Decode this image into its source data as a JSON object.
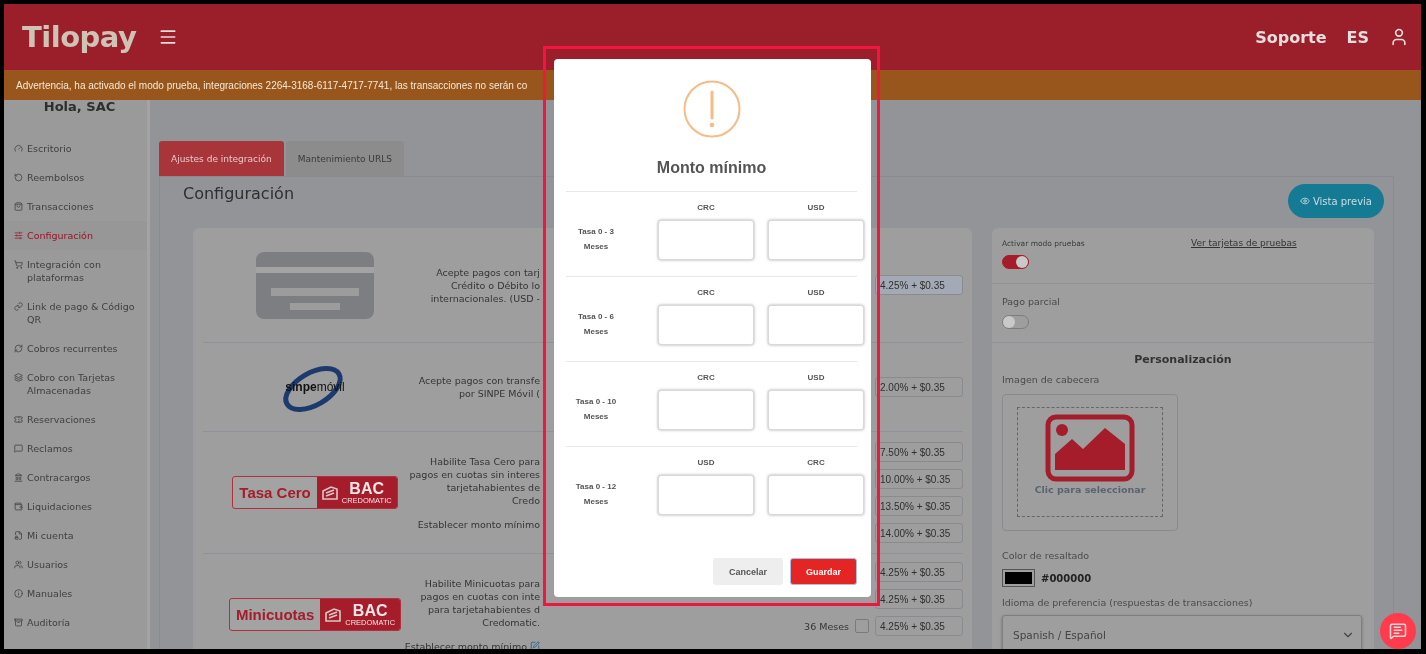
{
  "header": {
    "logo": "Tilopay",
    "links": [
      "Soporte",
      "ES"
    ]
  },
  "warning_bar": {
    "text": "Advertencia, ha activado el modo prueba, integraciones 2264-3168-6117-4717-7741, las transacciones no serán co"
  },
  "sidebar": {
    "greeting": "Hola, SAC",
    "items": [
      {
        "label": "Escritorio",
        "selected": false
      },
      {
        "label": "Reembolsos",
        "selected": false
      },
      {
        "label": "Transacciones",
        "selected": false
      },
      {
        "label": "Configuración",
        "selected": true
      },
      {
        "label": "Integración con plataformas",
        "selected": false
      },
      {
        "label": "Link de pago & Código QR",
        "selected": false
      },
      {
        "label": "Cobros recurrentes",
        "selected": false
      },
      {
        "label": "Cobro con Tarjetas Almacenadas",
        "selected": false
      },
      {
        "label": "Reservaciones",
        "selected": false
      },
      {
        "label": "Reclamos",
        "selected": false
      },
      {
        "label": "Contracargos",
        "selected": false
      },
      {
        "label": "Liquidaciones",
        "selected": false
      },
      {
        "label": "Mi cuenta",
        "selected": false
      },
      {
        "label": "Usuarios",
        "selected": false
      },
      {
        "label": "Manuales",
        "selected": false
      },
      {
        "label": "Auditoría",
        "selected": false
      }
    ]
  },
  "tabs": [
    {
      "label": "Ajustes de integración",
      "selected": true
    },
    {
      "label": "Mantenimiento URLS",
      "selected": false
    }
  ],
  "page_title": "Configuración",
  "preview_button": "Vista previa",
  "payment_methods": [
    {
      "kind": "card",
      "description_lines": [
        "Acepte pagos con tarj",
        "Crédito o Débito lo",
        "internacionales. (USD -"
      ],
      "fees": [
        {
          "value": "4.25% + $0.35",
          "highlighted": true
        }
      ]
    },
    {
      "kind": "sinpe",
      "logo": [
        "sinpe",
        "móvil"
      ],
      "description_lines": [
        "Acepte pagos con transfe",
        "por SINPE Móvil ("
      ],
      "fees": [
        {
          "value": "2.00% + $0.35",
          "highlighted": false
        }
      ]
    },
    {
      "kind": "bac",
      "logo": [
        "Tasa Cero",
        "BAC",
        "CREDOMATIC"
      ],
      "description_lines": [
        "Habilite Tasa Cero para",
        "pagos en cuotas sin interes",
        "tarjetahabientes de",
        "Credo"
      ],
      "min_amount_link": "Establecer monto mínimo",
      "fees": [
        {
          "value": "7.50% + $0.35",
          "highlighted": false
        },
        {
          "value": "10.00% + $0.35",
          "highlighted": false
        },
        {
          "value": "13.50% + $0.35",
          "highlighted": false
        },
        {
          "value": "14.00% + $0.35",
          "highlighted": false
        }
      ]
    },
    {
      "kind": "bac",
      "logo": [
        "Minicuotas",
        "BAC",
        "CREDOMATIC"
      ],
      "description_lines": [
        "Habilite Minicuotas para",
        "pagos en cuotas con inte",
        "para tarjetahabientes d",
        "Credomatic."
      ],
      "min_amount_link": "Establecer monto mínimo",
      "fees": [
        {
          "value": "4.25% + $0.35",
          "highlighted": false
        },
        {
          "value": "4.25% + $0.35",
          "highlighted": false
        },
        {
          "label": "36 Meses",
          "checked": false,
          "value": "4.25% + $0.35",
          "highlighted": false
        }
      ]
    }
  ],
  "settings": {
    "test_mode": {
      "label": "Activar modo pruebas",
      "on": true
    },
    "test_cards_link": "Ver tarjetas de pruebas",
    "partial_payment": {
      "label": "Pago parcial",
      "on": false
    },
    "customization": {
      "title": "Personalización",
      "header_image": {
        "label": "Imagen de cabecera",
        "hint": "Clic para seleccionar"
      },
      "highlight_color": {
        "label": "Color de resaltado",
        "value": "#000000"
      },
      "language": {
        "label": "Idioma de preferencia (respuestas de transacciones)",
        "value": "Spanish / Español"
      }
    }
  },
  "modal": {
    "title": "Monto mínimo",
    "rows": [
      {
        "label": "Tasa 0 - 3 Meses",
        "columns": [
          "CRC",
          "USD"
        ]
      },
      {
        "label": "Tasa 0 - 6 Meses",
        "columns": [
          "CRC",
          "USD"
        ]
      },
      {
        "label": "Tasa 0 - 10 Meses",
        "columns": [
          "CRC",
          "USD"
        ]
      },
      {
        "label": "Tasa 0 - 12 Meses",
        "columns": [
          "USD",
          "CRC"
        ]
      }
    ],
    "buttons": [
      {
        "label": "Cancelar",
        "kind": "secondary"
      },
      {
        "label": "Guardar",
        "kind": "primary"
      }
    ]
  }
}
